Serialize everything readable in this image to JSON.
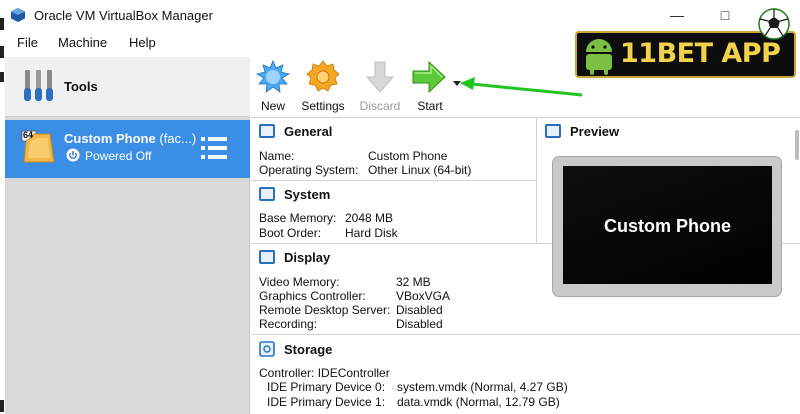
{
  "window": {
    "title": "Oracle VM VirtualBox Manager"
  },
  "menu": {
    "items": [
      "File",
      "Machine",
      "Help"
    ]
  },
  "sidebar": {
    "tools_label": "Tools",
    "vm": {
      "name": "Custom Phone",
      "name_suffix": "(fac...)",
      "status": "Powered Off",
      "badge": "64"
    }
  },
  "toolbar": {
    "new_label": "New",
    "settings_label": "Settings",
    "discard_label": "Discard",
    "start_label": "Start"
  },
  "details": {
    "general": {
      "title": "General",
      "rows": [
        {
          "key": "Name:",
          "value": "Custom Phone"
        },
        {
          "key": "Operating System:",
          "value": "Other Linux (64-bit)"
        }
      ]
    },
    "system": {
      "title": "System",
      "rows": [
        {
          "key": "Base Memory:",
          "value": "2048 MB"
        },
        {
          "key": "Boot Order:",
          "value": "Hard Disk"
        }
      ]
    },
    "display": {
      "title": "Display",
      "rows": [
        {
          "key": "Video Memory:",
          "value": "32 MB"
        },
        {
          "key": "Graphics Controller:",
          "value": "VBoxVGA"
        },
        {
          "key": "Remote Desktop Server:",
          "value": "Disabled"
        },
        {
          "key": "Recording:",
          "value": "Disabled"
        }
      ]
    },
    "storage": {
      "title": "Storage",
      "controller": "Controller: IDEController",
      "rows": [
        {
          "key": "IDE Primary Device 0:",
          "value": "system.vmdk (Normal, 4.27 GB)"
        },
        {
          "key": "IDE Primary Device 1:",
          "value": "data.vmdk (Normal, 12.79 GB)"
        }
      ]
    }
  },
  "preview": {
    "title": "Preview",
    "screen_text": "Custom Phone"
  },
  "promo": {
    "text": "11BET APP"
  },
  "colors": {
    "selection": "#3a8ee6",
    "annotation_arrow": "#22c41e",
    "promo_gold": "#f2d24a"
  },
  "icons": [
    "virtualbox-icon",
    "tools-icon",
    "new-icon",
    "settings-icon",
    "discard-icon",
    "start-icon",
    "power-icon",
    "vm-menu-icon",
    "preview-icon"
  ]
}
